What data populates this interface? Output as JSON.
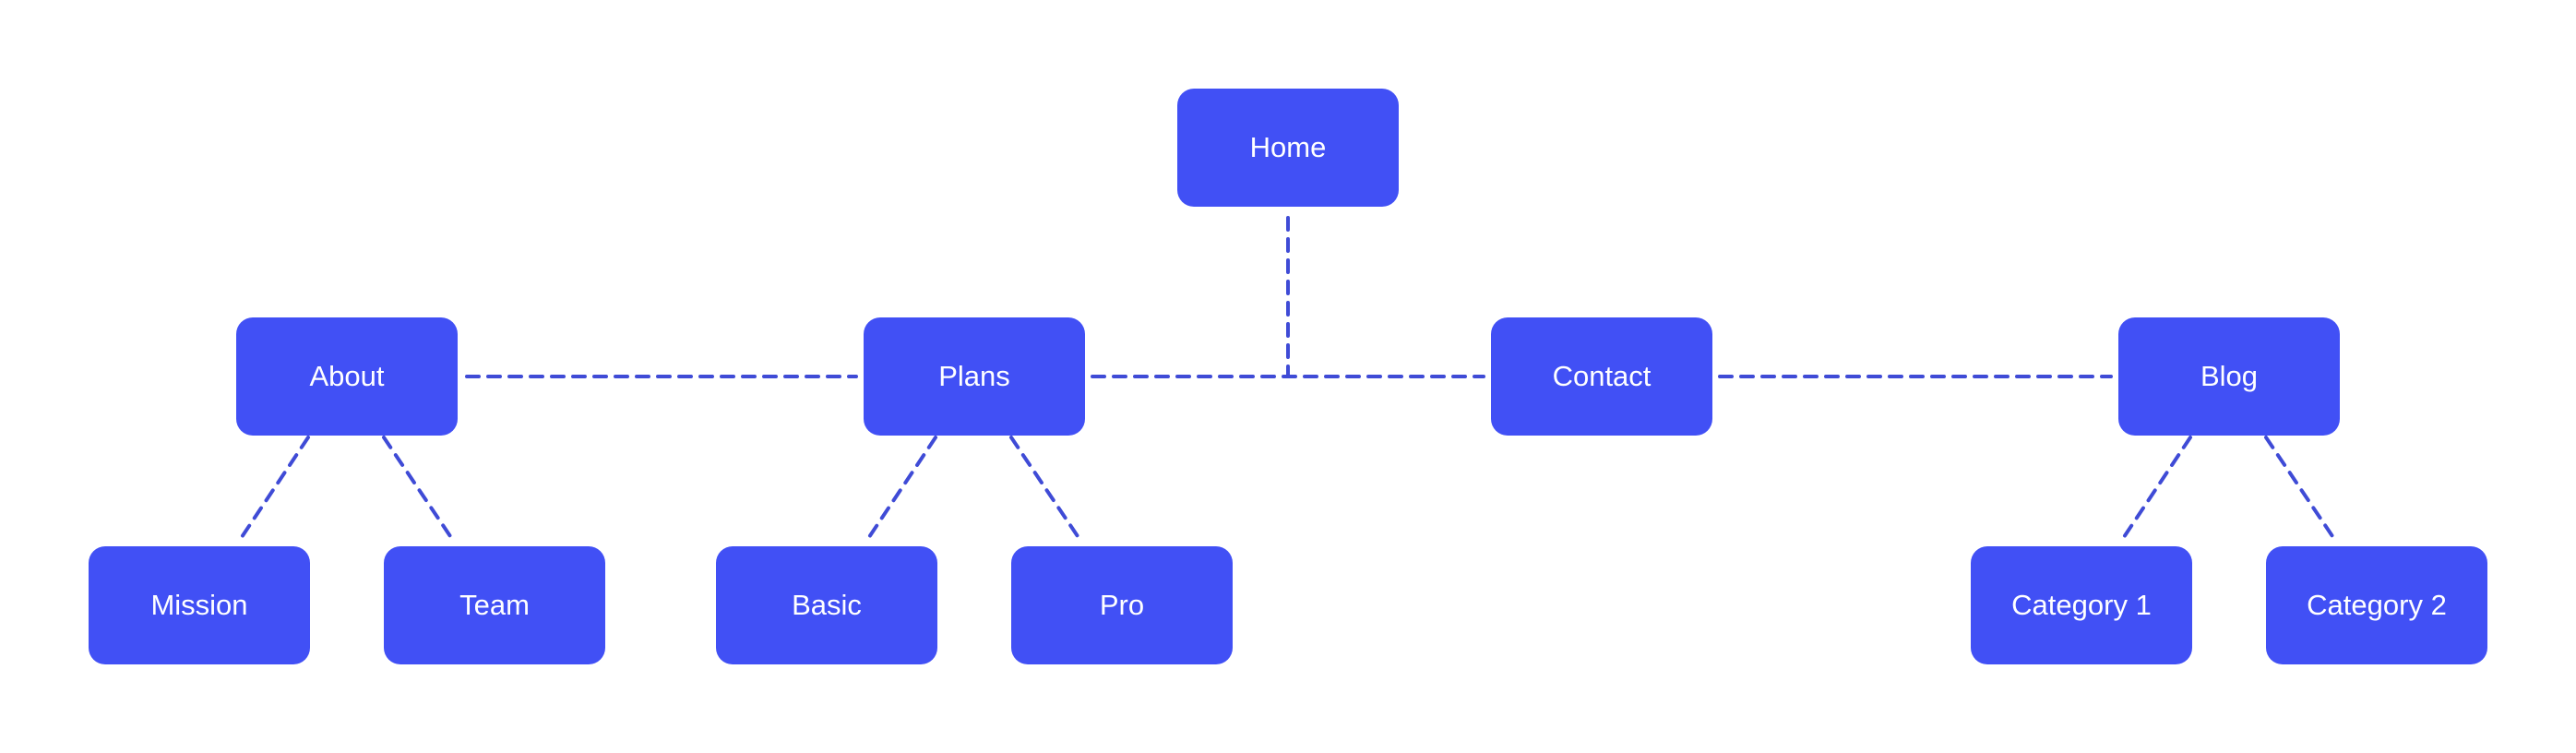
{
  "diagram": {
    "type": "sitemap-tree",
    "colors": {
      "node_fill": "#4150F5",
      "node_text": "#FFFFFF",
      "connector": "#3F4BD6",
      "background": "#FFFFFF"
    },
    "nodes": {
      "home": {
        "label": "Home"
      },
      "about": {
        "label": "About"
      },
      "plans": {
        "label": "Plans"
      },
      "contact": {
        "label": "Contact"
      },
      "blog": {
        "label": "Blog"
      },
      "mission": {
        "label": "Mission"
      },
      "team": {
        "label": "Team"
      },
      "basic": {
        "label": "Basic"
      },
      "pro": {
        "label": "Pro"
      },
      "category1": {
        "label": "Category 1"
      },
      "category2": {
        "label": "Category 2"
      }
    },
    "edges": [
      {
        "from": "home",
        "to": "about"
      },
      {
        "from": "home",
        "to": "plans"
      },
      {
        "from": "home",
        "to": "contact"
      },
      {
        "from": "home",
        "to": "blog"
      },
      {
        "from": "about",
        "to": "mission"
      },
      {
        "from": "about",
        "to": "team"
      },
      {
        "from": "plans",
        "to": "basic"
      },
      {
        "from": "plans",
        "to": "pro"
      },
      {
        "from": "blog",
        "to": "category1"
      },
      {
        "from": "blog",
        "to": "category2"
      }
    ],
    "connector_style": "dashed"
  }
}
